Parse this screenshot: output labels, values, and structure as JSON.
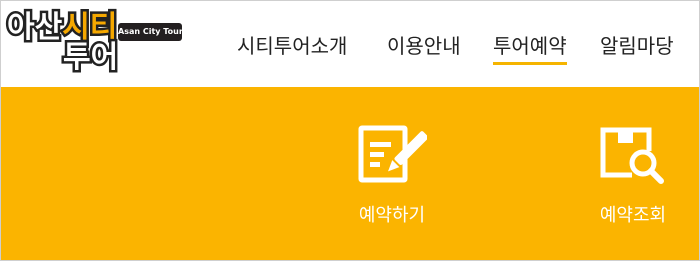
{
  "logo": {
    "line1_a": "아산",
    "line1_b": "시티",
    "line2": "투어",
    "subtitle": "Asan City Tour"
  },
  "nav": {
    "items": [
      {
        "label": "시티투어소개",
        "active": false
      },
      {
        "label": "이용안내",
        "active": false
      },
      {
        "label": "투어예약",
        "active": true
      },
      {
        "label": "알림마당",
        "active": false
      }
    ]
  },
  "quick_menu": {
    "items": [
      {
        "label": "예약하기",
        "icon": "edit-document-icon"
      },
      {
        "label": "예약조회",
        "icon": "box-search-icon"
      }
    ]
  },
  "colors": {
    "accent": "#fbb400",
    "nav_underline": "#f5b400",
    "text": "#222222"
  }
}
